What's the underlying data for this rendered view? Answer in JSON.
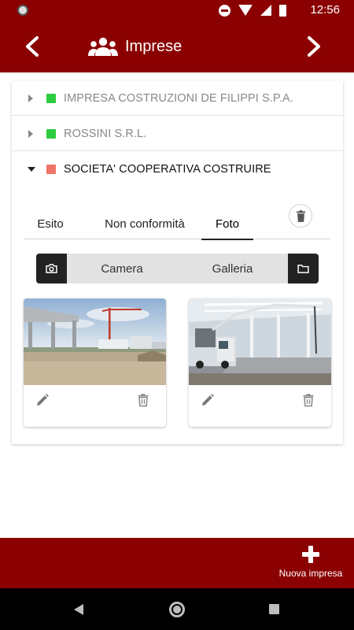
{
  "status_bar": {
    "time": "12:56",
    "icons": [
      "circle-icon",
      "dnd-icon",
      "wifi-icon",
      "signal-icon",
      "battery-icon"
    ]
  },
  "app_bar": {
    "title": "Imprese",
    "title_icon": "group-icon",
    "prev_icon": "chevron-left-icon",
    "next_icon": "chevron-right-icon"
  },
  "companies": [
    {
      "name": "IMPRESA COSTRUZIONI DE FILIPPI S.P.A.",
      "status_color": "#2ecc40",
      "expanded": false
    },
    {
      "name": "ROSSINI S.R.L.",
      "status_color": "#2ecc40",
      "expanded": false
    },
    {
      "name": "SOCIETA' COOPERATIVA COSTRUIRE",
      "status_color": "#f07468",
      "expanded": true
    }
  ],
  "detail": {
    "tabs": [
      {
        "label": "Esito",
        "active": false
      },
      {
        "label": "Non conformità",
        "active": false
      },
      {
        "label": "Foto",
        "active": true
      }
    ],
    "source_selector": {
      "camera_label": "Camera",
      "gallery_label": "Galleria"
    },
    "photos": [
      {
        "subject": "construction-site-photo",
        "actions": [
          "edit-icon",
          "trash-icon"
        ]
      },
      {
        "subject": "concrete-pouring-photo",
        "actions": [
          "edit-icon",
          "trash-icon"
        ]
      }
    ]
  },
  "bottom_bar": {
    "new_label": "Nuova impresa"
  },
  "colors": {
    "primary": "#8b0000",
    "status_ok": "#2ecc40",
    "status_warn": "#f07468"
  }
}
